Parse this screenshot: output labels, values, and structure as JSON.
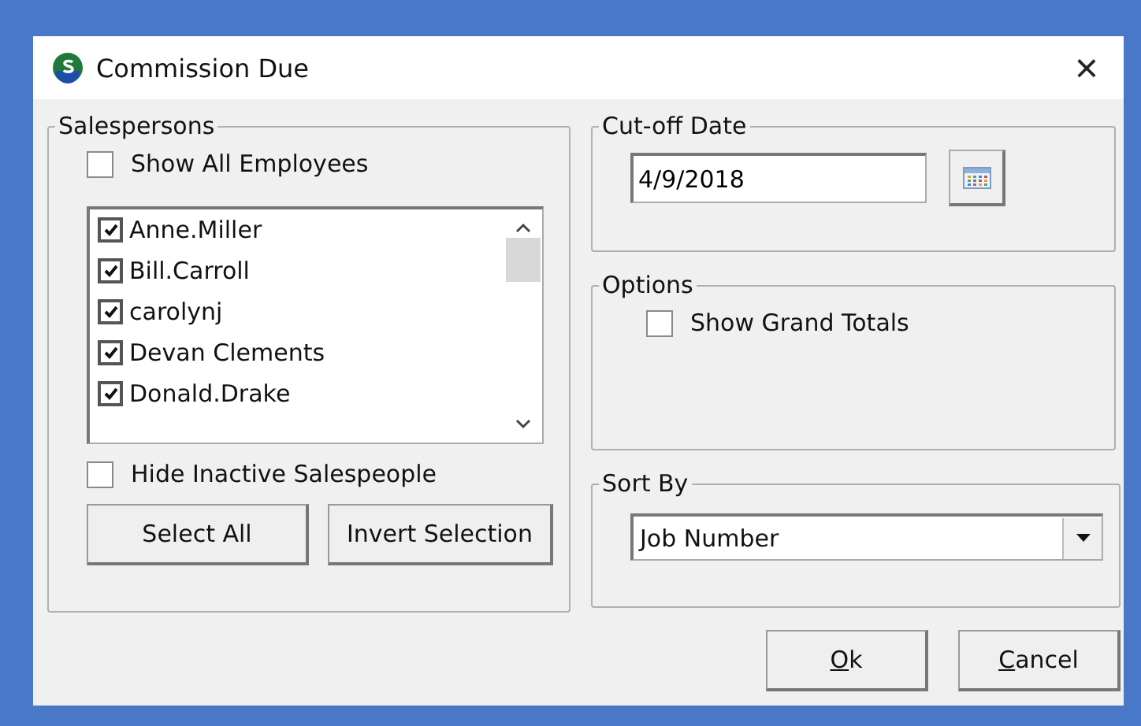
{
  "window": {
    "title": "Commission Due",
    "close": "×"
  },
  "salespersons": {
    "title": "Salespersons",
    "show_all": {
      "label": "Show All Employees",
      "checked": false
    },
    "list": [
      {
        "name": "Anne.Miller",
        "checked": true
      },
      {
        "name": "Bill.Carroll",
        "checked": true
      },
      {
        "name": "carolynj",
        "checked": true
      },
      {
        "name": "Devan Clements",
        "checked": true
      },
      {
        "name": "Donald.Drake",
        "checked": true
      }
    ],
    "hide_inactive": {
      "label": "Hide Inactive Salespeople",
      "checked": false
    },
    "buttons": [
      "Select All",
      "Invert Selection"
    ]
  },
  "cutoff": {
    "title": "Cut-off Date",
    "value": "4/9/2018"
  },
  "options": {
    "title": "Options",
    "items": [
      {
        "label": "Show Grand Totals",
        "checked": false
      }
    ]
  },
  "sort_by": {
    "title": "Sort By",
    "value": "Job Number"
  },
  "buttons": [
    {
      "access": "O",
      "rest": "k"
    },
    {
      "access": "C",
      "rest": "ancel"
    }
  ]
}
